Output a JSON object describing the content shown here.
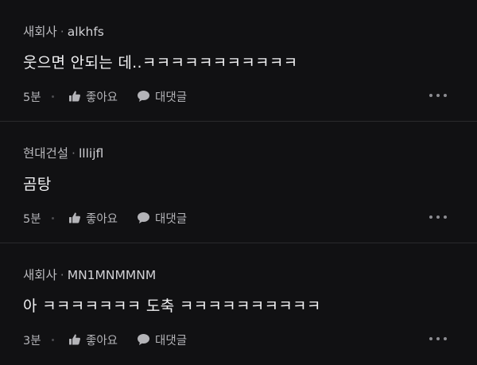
{
  "comments": [
    {
      "company": "새회사",
      "separator": "·",
      "username": "alkhfs",
      "text": "웃으면 안되는 데..ㅋㅋㅋㅋㅋㅋㅋㅋㅋㅋㅋ",
      "time": "5분",
      "like_label": "좋아요",
      "reply_label": "대댓글"
    },
    {
      "company": "현대건설",
      "separator": "·",
      "username": "lllijfl",
      "text": "곰탕",
      "time": "5분",
      "like_label": "좋아요",
      "reply_label": "대댓글"
    },
    {
      "company": "새회사",
      "separator": "·",
      "username": "MN1MNMMNM",
      "text": "아 ㅋㅋㅋㅋㅋㅋㅋ 도축 ㅋㅋㅋㅋㅋㅋㅋㅋㅋㅋ",
      "time": "3분",
      "like_label": "좋아요",
      "reply_label": "대댓글"
    }
  ],
  "icons": {
    "like": "thumbs-up-icon",
    "reply": "speech-bubble-icon",
    "more": "more-horizontal-icon"
  },
  "colors": {
    "background": "#111113",
    "text_primary": "#f2f2f4",
    "text_secondary": "#b9b9bd",
    "divider": "#2a2a2d"
  }
}
